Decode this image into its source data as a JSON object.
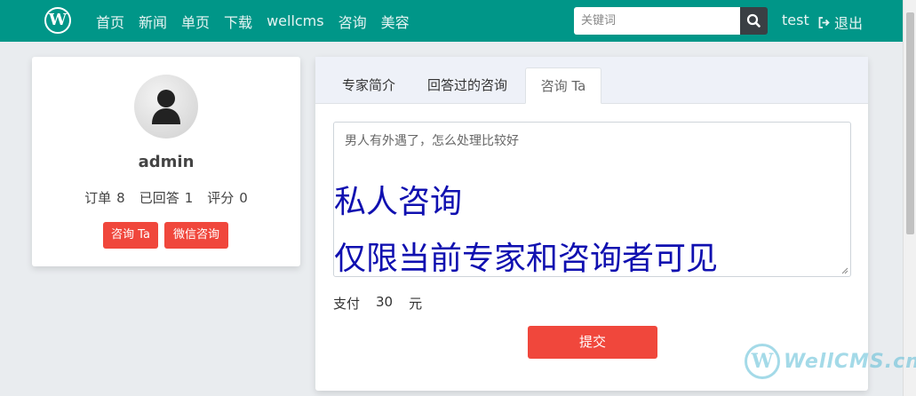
{
  "navbar": {
    "logo_letter": "W",
    "links": [
      "首页",
      "新闻",
      "单页",
      "下载",
      "wellcms",
      "咨询",
      "美容"
    ],
    "search_placeholder": "关键词",
    "user": "test",
    "logout": "退出",
    "color": "#009688"
  },
  "profile": {
    "name": "admin",
    "stats": [
      {
        "label": "订单",
        "value": "8"
      },
      {
        "label": "已回答",
        "value": "1"
      },
      {
        "label": "评分",
        "value": "0"
      }
    ],
    "consult_button": "咨询 Ta",
    "wechat_button": "微信咨询"
  },
  "tabs": [
    {
      "label": "专家简介",
      "active": false
    },
    {
      "label": "回答过的咨询",
      "active": false
    },
    {
      "label": "咨询 Ta",
      "active": true
    }
  ],
  "form": {
    "question_placeholder": "男人有外遇了，怎么处理比较好",
    "overlay_line1": "私人咨询",
    "overlay_line2": "仅限当前专家和咨询者可见",
    "pay_label": "支付",
    "pay_amount": "30",
    "pay_unit": "元",
    "submit": "提交"
  },
  "watermark": {
    "logo_letter": "W",
    "text": "WellCMS.cn"
  },
  "colors": {
    "accent_red": "#f0473c",
    "overlay_blue": "#1010b0"
  }
}
